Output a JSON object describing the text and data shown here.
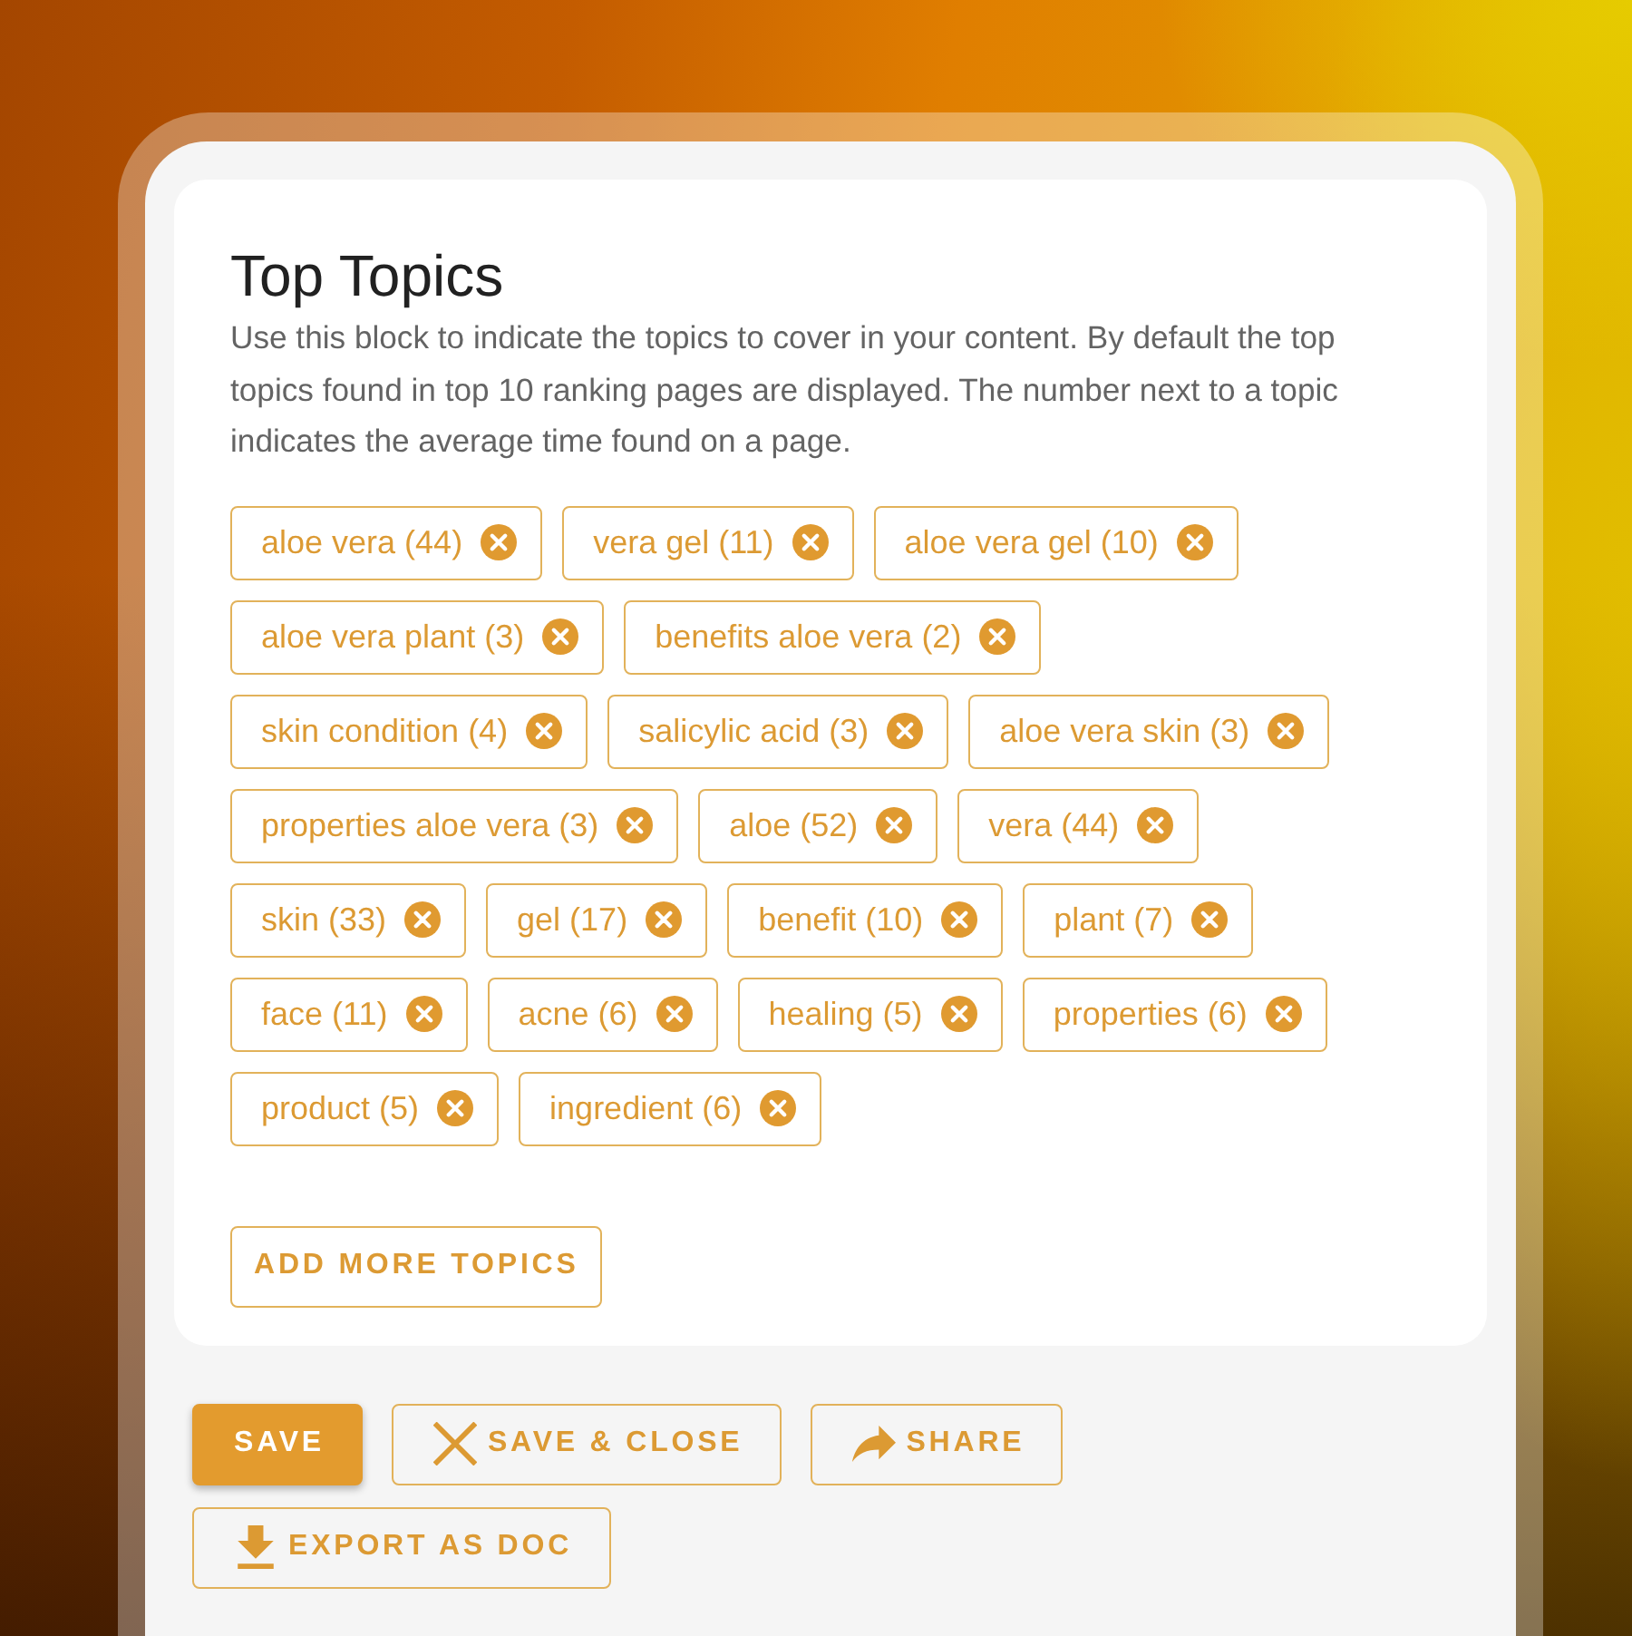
{
  "card": {
    "title": "Top Topics",
    "description": "Use this block to indicate the topics to cover in your content. By default the top topics found in top 10 ranking pages are displayed. The number next to a topic indicates the average time found on a page.",
    "topics": [
      {
        "label": "aloe vera (44)"
      },
      {
        "label": "vera gel (11)"
      },
      {
        "label": "aloe vera gel (10)"
      },
      {
        "label": "aloe vera plant (3)"
      },
      {
        "label": "benefits aloe vera (2)"
      },
      {
        "label": "skin condition (4)"
      },
      {
        "label": "salicylic acid (3)"
      },
      {
        "label": "aloe vera skin (3)"
      },
      {
        "label": "properties aloe vera (3)"
      },
      {
        "label": "aloe (52)"
      },
      {
        "label": "vera (44)"
      },
      {
        "label": "skin (33)"
      },
      {
        "label": "gel (17)"
      },
      {
        "label": "benefit (10)"
      },
      {
        "label": "plant (7)"
      },
      {
        "label": "face (11)"
      },
      {
        "label": "acne (6)"
      },
      {
        "label": "healing (5)"
      },
      {
        "label": "properties (6)"
      },
      {
        "label": "product (5)"
      },
      {
        "label": "ingredient (6)"
      }
    ],
    "add_button": "ADD MORE TOPICS"
  },
  "actions": [
    {
      "kind": "save",
      "label": "SAVE"
    },
    {
      "kind": "save_close",
      "label": "SAVE & CLOSE"
    },
    {
      "kind": "share",
      "label": "SHARE"
    },
    {
      "kind": "export",
      "label": "EXPORT AS DOC"
    }
  ]
}
